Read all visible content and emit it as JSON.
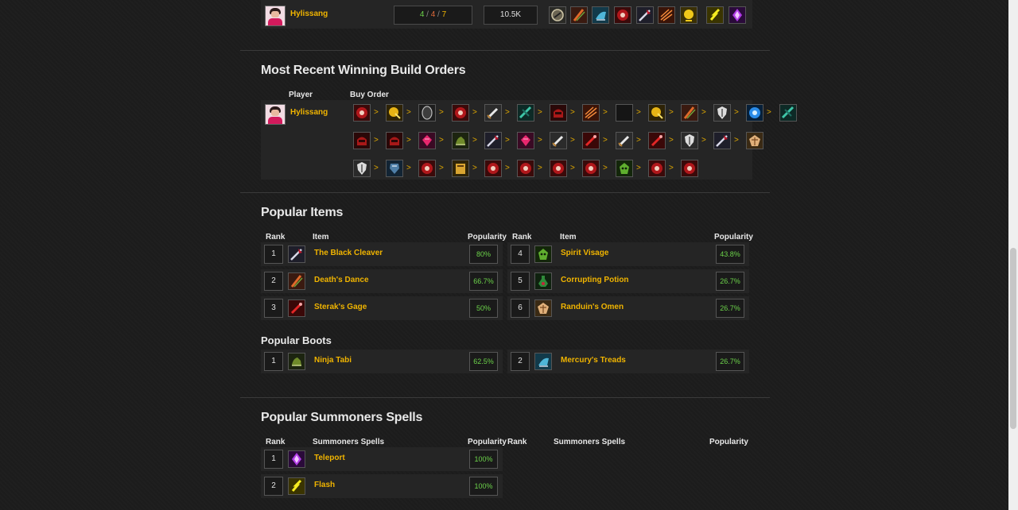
{
  "top_row": {
    "player": "Hylissang",
    "kda": {
      "kills": "4",
      "sep1": " / ",
      "deaths": "4",
      "sep2": " / ",
      "assists": "7"
    },
    "gold": "10.5K",
    "items": [
      "orb-icon",
      "dancing-blade-icon",
      "mercury-treads-icon",
      "red-orb-icon",
      "black-cleaver-icon",
      "sword-slash-icon",
      "yellow-orb-icon",
      "flash-icon",
      "teleport-icon"
    ]
  },
  "build_orders": {
    "title": "Most Recent Winning Build Orders",
    "col_player": "Player",
    "col_buy_order": "Buy Order",
    "player": "Hylissang",
    "arrow": ">",
    "rows": [
      [
        "red-orb-icon",
        "golden-crest-icon",
        "dark-shield-icon",
        "red-orb-icon",
        "dagger-icon",
        "teal-blade-icon",
        "red-helm-icon",
        "sword-slash-icon",
        "black-crescent-icon",
        "golden-crest-icon",
        "dancing-blade-icon",
        "white-shield-icon",
        "blue-orb-icon",
        "teal-blade-icon"
      ],
      [
        "red-helm-icon",
        "red-helm-icon",
        "pink-gem-icon",
        "ninja-tabi-icon",
        "black-cleaver-icon",
        "pink-gem-icon",
        "dagger-icon",
        "red-blade-icon",
        "dagger-icon",
        "red-blade-icon",
        "white-shield-icon",
        "black-cleaver-icon",
        "randuin-icon"
      ],
      [
        "white-shield-icon",
        "armor-icon",
        "red-orb-icon",
        "golden-book-icon",
        "red-orb-icon",
        "red-orb-icon",
        "red-orb-icon",
        "red-orb-icon",
        "spirit-visage-icon",
        "red-orb-icon",
        "red-orb-icon"
      ]
    ]
  },
  "popular_items": {
    "title": "Popular Items",
    "col_rank": "Rank",
    "col_item": "Item",
    "col_popularity": "Popularity",
    "left": [
      {
        "rank": "1",
        "name": "The Black Cleaver",
        "pop": "80%",
        "icon": "black-cleaver-icon"
      },
      {
        "rank": "2",
        "name": "Death's Dance",
        "pop": "66.7%",
        "icon": "dancing-blade-icon"
      },
      {
        "rank": "3",
        "name": "Sterak's Gage",
        "pop": "50%",
        "icon": "red-blade-icon"
      }
    ],
    "right": [
      {
        "rank": "4",
        "name": "Spirit Visage",
        "pop": "43.8%",
        "icon": "spirit-visage-icon"
      },
      {
        "rank": "5",
        "name": "Corrupting Potion",
        "pop": "26.7%",
        "icon": "corrupting-potion-icon"
      },
      {
        "rank": "6",
        "name": "Randuin's Omen",
        "pop": "26.7%",
        "icon": "randuin-icon"
      }
    ]
  },
  "popular_boots": {
    "title": "Popular Boots",
    "left": [
      {
        "rank": "1",
        "name": "Ninja Tabi",
        "pop": "62.5%",
        "icon": "ninja-tabi-icon"
      }
    ],
    "right": [
      {
        "rank": "2",
        "name": "Mercury's Treads",
        "pop": "26.7%",
        "icon": "mercury-treads-icon"
      }
    ]
  },
  "popular_spells": {
    "title": "Popular Summoners Spells",
    "col_rank": "Rank",
    "col_spells": "Summoners Spells",
    "col_popularity": "Popularity",
    "left": [
      {
        "rank": "1",
        "name": "Teleport",
        "pop": "100%",
        "icon": "teleport-icon"
      },
      {
        "rank": "2",
        "name": "Flash",
        "pop": "100%",
        "icon": "flash-icon"
      }
    ]
  },
  "colors": {
    "gold_text": "#f0b400",
    "green_text": "#6cd34a",
    "background": "#1c1c1c",
    "panel": "#252525"
  }
}
